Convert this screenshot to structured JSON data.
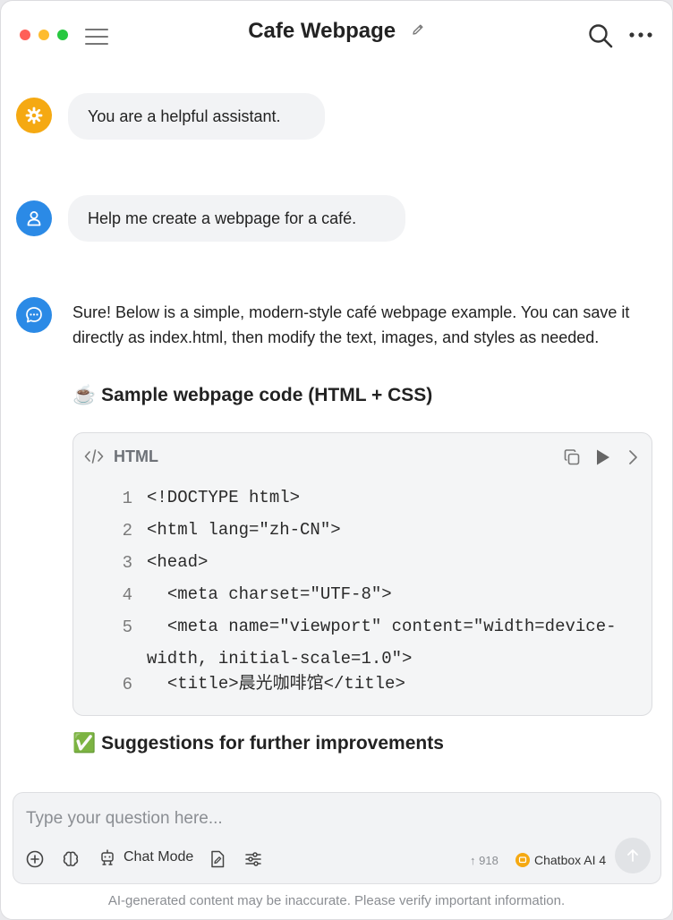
{
  "header": {
    "title": "Cafe Webpage"
  },
  "messages": {
    "system": "You are a helpful assistant.",
    "user": "Help me create a webpage for a café.",
    "assistant_intro": "Sure! Below is a simple, modern-style café webpage example. You can save it directly as index.html, then modify the text, images, and styles as needed.",
    "section1_emoji": "☕",
    "section1_title": "Sample webpage code (HTML + CSS)",
    "section2_emoji": "✅",
    "section2_title": "Suggestions for further improvements"
  },
  "code": {
    "language": "HTML",
    "lines": [
      {
        "n": "1",
        "text": "<!DOCTYPE html>"
      },
      {
        "n": "2",
        "text": "<html lang=\"zh-CN\">"
      },
      {
        "n": "3",
        "text": "<head>"
      },
      {
        "n": "4",
        "text": "  <meta charset=\"UTF-8\">"
      },
      {
        "n": "5",
        "text": "  <meta name=\"viewport\" content=\"width=device-width, initial-scale=1.0\">"
      },
      {
        "n": "6",
        "text": "  <title>晨光咖啡馆</title>"
      }
    ]
  },
  "composer": {
    "placeholder": "Type your question here...",
    "chat_mode_label": "Chat Mode",
    "token_count": "↑ 918",
    "model_label": "Chatbox AI 4"
  },
  "footer": {
    "disclaimer": "AI-generated content may be inaccurate. Please verify important information."
  },
  "colors": {
    "accent_blue": "#2b8ae6",
    "system_orange": "#f5a912",
    "bubble_bg": "#f2f3f5"
  },
  "icons": [
    "hamburger-menu-icon",
    "edit-icon",
    "search-icon",
    "more-icon",
    "gear-icon",
    "user-icon",
    "chat-bubble-icon",
    "code-icon",
    "copy-icon",
    "play-icon",
    "chevron-right-icon",
    "plus-circle-icon",
    "brain-icon",
    "robot-icon",
    "document-edit-icon",
    "sliders-icon",
    "arrow-up-icon"
  ]
}
